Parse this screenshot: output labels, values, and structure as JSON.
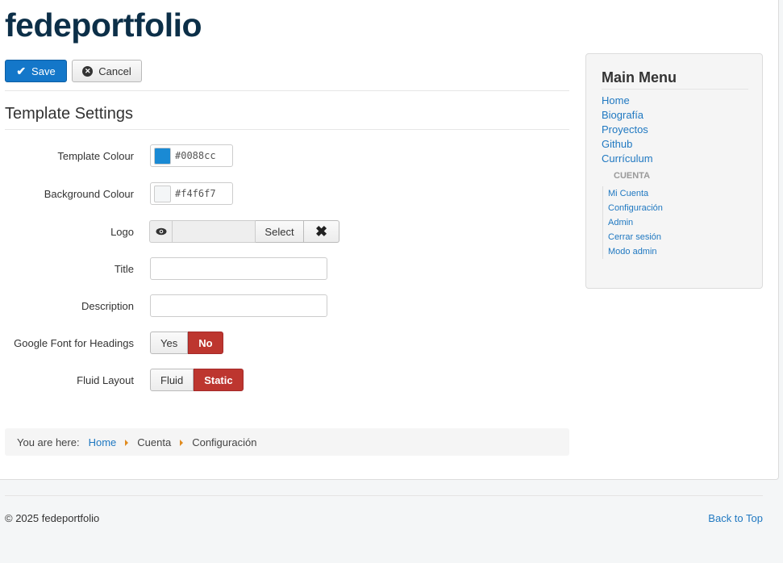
{
  "site": {
    "title": "fedeportfolio"
  },
  "toolbar": {
    "save_label": "Save",
    "cancel_label": "Cancel"
  },
  "section": {
    "title": "Template Settings"
  },
  "form": {
    "template_colour": {
      "label": "Template Colour",
      "value": "#0088cc",
      "swatch": "#1a8ad4"
    },
    "background_colour": {
      "label": "Background Colour",
      "value": "#f4f6f7",
      "swatch": "#f4f6f7"
    },
    "logo": {
      "label": "Logo",
      "select_label": "Select",
      "preview_icon": "eye-icon",
      "clear_icon": "x-icon"
    },
    "title": {
      "label": "Title",
      "value": ""
    },
    "description": {
      "label": "Description",
      "value": ""
    },
    "google_font": {
      "label": "Google Font for Headings",
      "option_yes": "Yes",
      "option_no": "No",
      "selected": "No"
    },
    "fluid_layout": {
      "label": "Fluid Layout",
      "option_fluid": "Fluid",
      "option_static": "Static",
      "selected": "Static"
    }
  },
  "breadcrumb": {
    "prefix": "You are here:",
    "items": [
      "Home",
      "Cuenta",
      "Configuración"
    ]
  },
  "sidebar": {
    "title": "Main Menu",
    "main_items": [
      "Home",
      "Biografía",
      "Proyectos",
      "Github",
      "Currículum"
    ],
    "section_header": "CUENTA",
    "sub_items": [
      "Mi Cuenta",
      "Configuración",
      "Admin",
      "Cerrar sesión",
      "Modo admin"
    ]
  },
  "footer": {
    "copyright": "© 2025 fedeportfolio",
    "back_to_top": "Back to Top"
  },
  "colors": {
    "accent": "#1477c9",
    "active_toggle": "#bd362f",
    "title": "#0c2f48",
    "link": "#1f78c1"
  }
}
